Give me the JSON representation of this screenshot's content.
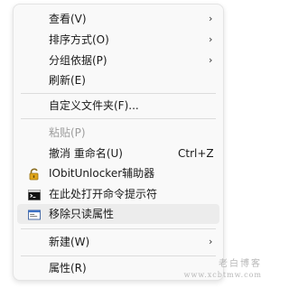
{
  "menu": {
    "items": [
      {
        "label": "查看(V)",
        "shortcut": "",
        "arrow": "›"
      },
      {
        "label": "排序方式(O)",
        "shortcut": "",
        "arrow": "›"
      },
      {
        "label": "分组依据(P)",
        "shortcut": "",
        "arrow": "›"
      },
      {
        "label": "刷新(E)",
        "shortcut": "",
        "arrow": ""
      },
      {
        "label": "自定义文件夹(F)...",
        "shortcut": "",
        "arrow": ""
      },
      {
        "label": "粘贴(P)",
        "shortcut": "",
        "arrow": "",
        "disabled": true
      },
      {
        "label": "撤消 重命名(U)",
        "shortcut": "Ctrl+Z",
        "arrow": ""
      },
      {
        "label": "IObitUnlocker辅助器",
        "shortcut": "",
        "arrow": "",
        "icon": "lock-icon"
      },
      {
        "label": "在此处打开命令提示符",
        "shortcut": "",
        "arrow": "",
        "icon": "command-prompt-icon"
      },
      {
        "label": "移除只读属性",
        "shortcut": "",
        "arrow": "",
        "icon": "window-icon"
      },
      {
        "label": "新建(W)",
        "shortcut": "",
        "arrow": "›"
      },
      {
        "label": "属性(R)",
        "shortcut": "",
        "arrow": ""
      }
    ]
  },
  "watermark": {
    "line1": "老白博客",
    "line2": "www.xcbtmw.com"
  }
}
